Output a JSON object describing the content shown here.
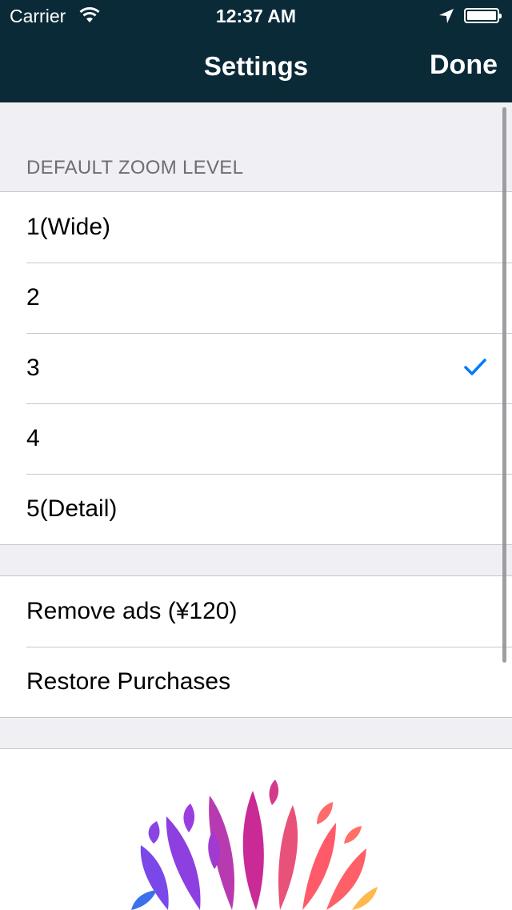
{
  "status_bar": {
    "carrier": "Carrier",
    "time": "12:37 AM",
    "icons": [
      "wifi-icon",
      "location-icon",
      "battery-icon"
    ]
  },
  "nav": {
    "title": "Settings",
    "done_label": "Done"
  },
  "zoom_section": {
    "header": "DEFAULT ZOOM LEVEL",
    "options": [
      "1(Wide)",
      "2",
      "3",
      "4",
      "5(Detail)"
    ],
    "selected": "3"
  },
  "purchase_section": {
    "remove_ads": "Remove ads (¥120)",
    "restore": "Restore Purchases"
  },
  "colors": {
    "nav_bg": "#0b2a38",
    "accent": "#007aff",
    "group_bg": "#efeff4"
  }
}
